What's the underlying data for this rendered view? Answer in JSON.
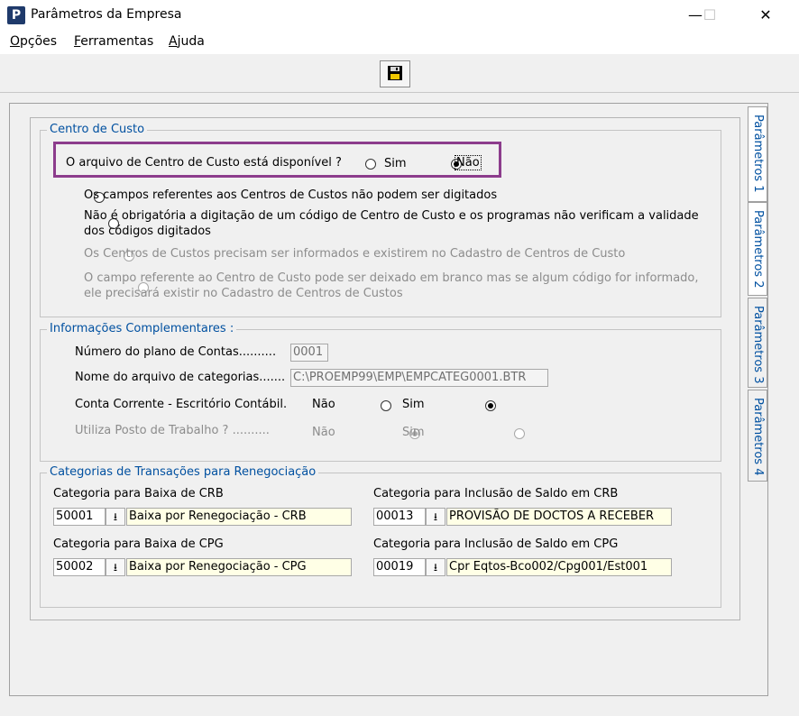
{
  "window": {
    "title": "Parâmetros da Empresa",
    "app_icon": "P"
  },
  "menu": [
    {
      "underline": "O",
      "rest": "pções"
    },
    {
      "underline": "F",
      "rest": "erramentas"
    },
    {
      "underline": "A",
      "rest": "juda"
    }
  ],
  "tabs": [
    "Parâmetros 1",
    "Parâmetros 2",
    "Parâmetros 3",
    "Parâmetros 4"
  ],
  "centro_custo": {
    "title": "Centro de Custo",
    "question": "O arquivo de  Centro de Custo  está disponível ?",
    "opt_sim": "Sim",
    "opt_nao": "Não",
    "opt1": "Os campos referentes aos Centros de Custos não podem ser digitados",
    "opt2_line1": "Não é obrigatória a digitação de um código de Centro de Custo e os programas não verificam a validade",
    "opt2_line2": "dos códigos digitados",
    "opt3": "Os Centros de Custos precisam ser informados e existirem no Cadastro de Centros de Custo",
    "opt4_line1": "O campo referente ao Centro de Custo pode ser deixado em branco mas se algum código for informado,",
    "opt4_line2": "ele precisará existir no Cadastro de Centros de Custos"
  },
  "info": {
    "title": "Informações Complementares :",
    "plano_label": "Número do plano de Contas..........",
    "plano_value": "0001",
    "arquivo_label": "Nome do arquivo de categorias.......",
    "arquivo_value": "C:\\PROEMP99\\EMP\\EMPCATEG0001.BTR",
    "conta_label": "Conta Corrente - Escritório Contábil.",
    "conta_nao": "Não",
    "conta_sim": "Sim",
    "posto_label": "Utiliza Posto de Trabalho ? ..........",
    "posto_nao": "Não",
    "posto_sim": "Sim"
  },
  "categorias": {
    "title": "Categorias de Transações para Renegociação",
    "baixa_crb_label": "Categoria para Baixa de CRB",
    "baixa_crb_code": "50001",
    "baixa_crb_desc": "Baixa por Renegociação - CRB",
    "inclusao_crb_label": "Categoria para Inclusão de Saldo em CRB",
    "inclusao_crb_code": "00013",
    "inclusao_crb_desc": "PROVISÃO DE DOCTOS A RECEBER",
    "baixa_cpg_label": "Categoria para Baixa de CPG",
    "baixa_cpg_code": "50002",
    "baixa_cpg_desc": "Baixa por Renegociação - CPG",
    "inclusao_cpg_label": "Categoria para Inclusão de Saldo em CPG",
    "inclusao_cpg_code": "00019",
    "inclusao_cpg_desc": "Cpr Eqtos-Bco002/Cpg001/Est001"
  },
  "colors": {
    "accent": "#0050a0",
    "highlight": "#8c3c8c",
    "field_yellow": "#ffffe6"
  }
}
